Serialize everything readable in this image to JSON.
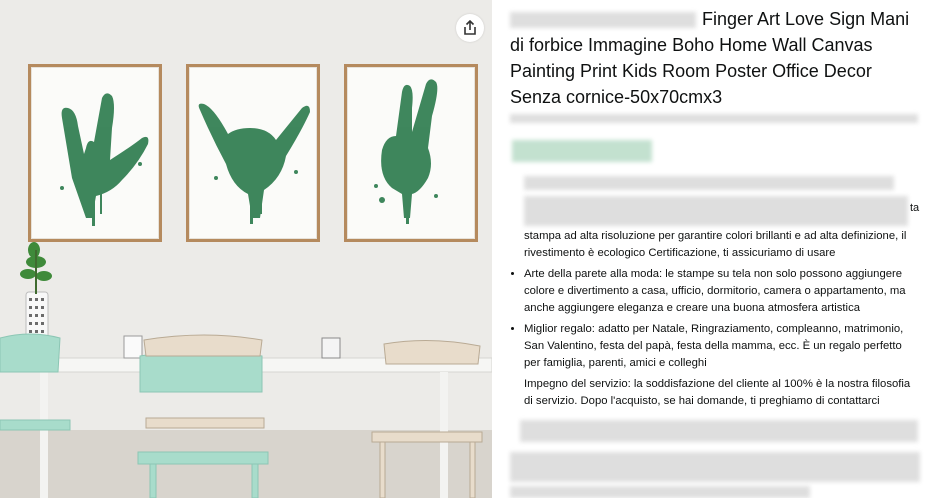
{
  "product": {
    "title": "Finger Art Love Sign Mani di forbice Immagine Boho Home Wall Canvas Painting Print Kids Room Poster Office Decor Senza cornice-50x70cmx3",
    "bullet_intro_tail": "ta",
    "bullet_intro": "stampa ad alta risoluzione per garantire colori brillanti e ad alta definizione, il rivestimento è ecologico Certificazione, ti assicuriamo di usare",
    "bullets": [
      "Arte della parete alla moda: le stampe su tela non solo possono aggiungere colore e divertimento a casa, ufficio, dormitorio, camera o appartamento, ma anche aggiungere eleganza e creare una buona atmosfera artistica",
      "Miglior regalo: adatto per Natale, Ringraziamento, compleanno, matrimonio, San Valentino, festa del papà, festa della mamma, ecc. È un regalo perfetto per famiglia, parenti, amici e colleghi",
      "Impegno del servizio: la soddisfazione del cliente al 100% è la nostra filosofia di servizio. Dopo l'acquisto, se hai domande, ti preghiamo di contattarci immediatamente, ti risponderemo entro 24 ore e ci assicureremo che le tue"
    ]
  },
  "image": {
    "share_icon": "share-icon",
    "paintings": [
      "love-sign-hand",
      "shaka-hand",
      "peace-sign-hand"
    ],
    "paint_color": "#2f7d4f"
  },
  "colors": {
    "frame": "#b58a5e",
    "chair": "#9fd8c7",
    "text": "#0f1111"
  }
}
